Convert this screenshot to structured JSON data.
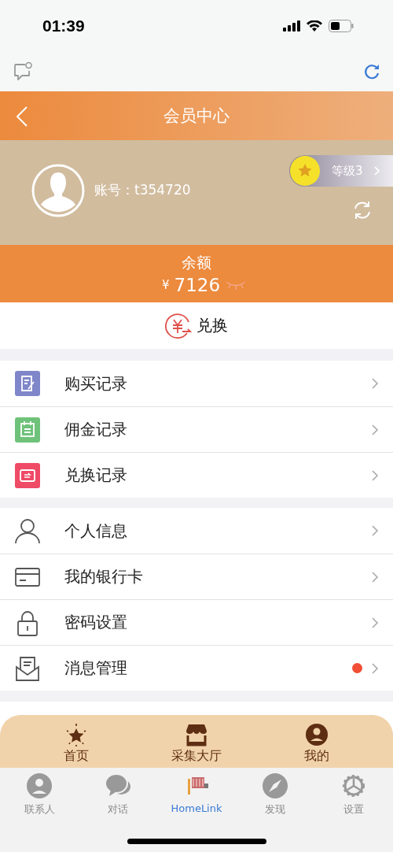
{
  "status_bar": {
    "time": "01:39"
  },
  "header": {
    "title": "会员中心"
  },
  "profile": {
    "account": "账号：t354720",
    "level": "等级3"
  },
  "balance": {
    "label": "余额",
    "currency": "¥",
    "amount": "7126"
  },
  "exchange": {
    "label": "兑换"
  },
  "menu_groups": [
    [
      {
        "label": "购买记录",
        "badge": false
      },
      {
        "label": "佣金记录",
        "badge": false
      },
      {
        "label": "兑换记录",
        "badge": false
      }
    ],
    [
      {
        "label": "个人信息",
        "badge": false
      },
      {
        "label": "我的银行卡",
        "badge": false
      },
      {
        "label": "密码设置",
        "badge": false
      },
      {
        "label": "消息管理",
        "badge": true
      }
    ]
  ],
  "app_tabs": [
    {
      "label": "首页"
    },
    {
      "label": "采集大厅"
    },
    {
      "label": "我的"
    }
  ],
  "system_tabs": [
    {
      "label": "联系人",
      "selected": false
    },
    {
      "label": "对话",
      "selected": false
    },
    {
      "label": "HomeLink",
      "selected": true
    },
    {
      "label": "发现",
      "selected": false
    },
    {
      "label": "设置",
      "selected": false
    }
  ]
}
